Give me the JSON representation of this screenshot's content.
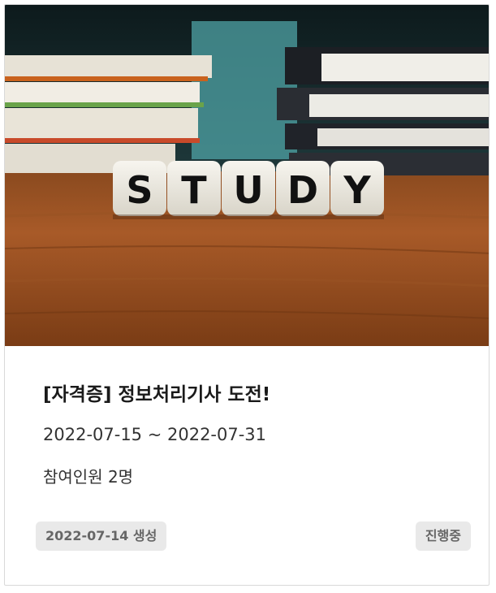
{
  "card": {
    "image_alt": "STUDY",
    "dice_letters": [
      "S",
      "T",
      "U",
      "D",
      "Y"
    ],
    "title": "[자격증] 정보처리기사 도전!",
    "period": "2022-07-15 ~ 2022-07-31",
    "participants": "참여인원 2명",
    "created_badge": "2022-07-14 생성",
    "status_badge": "진행중"
  }
}
